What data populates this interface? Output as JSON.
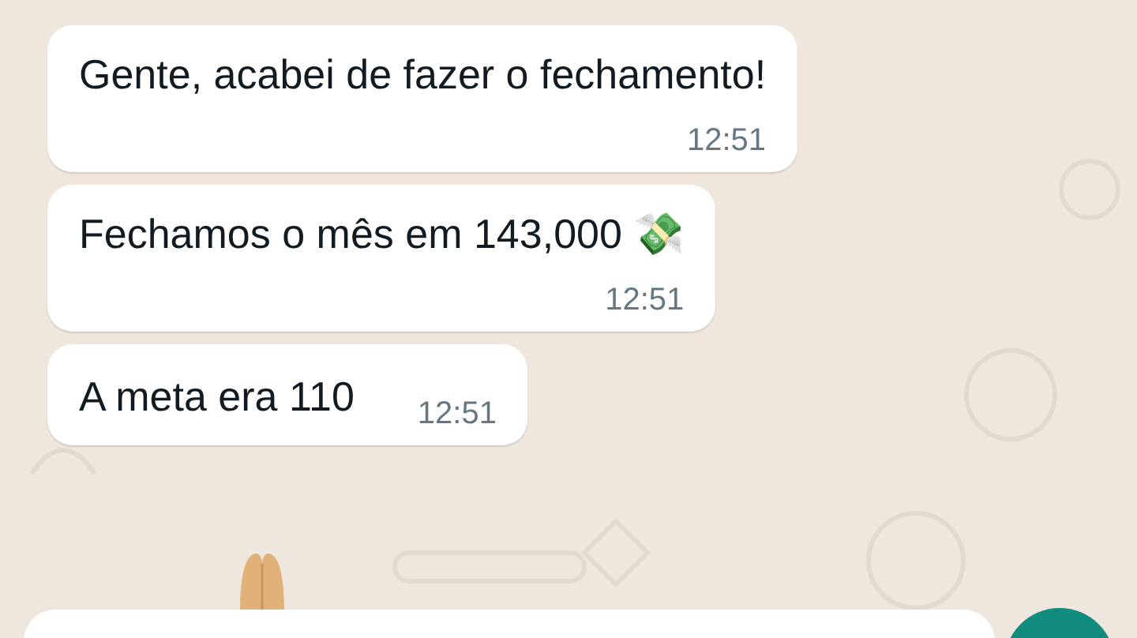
{
  "messages": [
    {
      "kind": "stacked",
      "text": "Gente, acabei de fazer o fechamento!",
      "time": "12:51"
    },
    {
      "kind": "stacked",
      "text": "Fechamos o mês em 143,000 💸",
      "time": "12:51"
    },
    {
      "kind": "inline",
      "text": "A meta era 110",
      "time": "12:51"
    }
  ]
}
